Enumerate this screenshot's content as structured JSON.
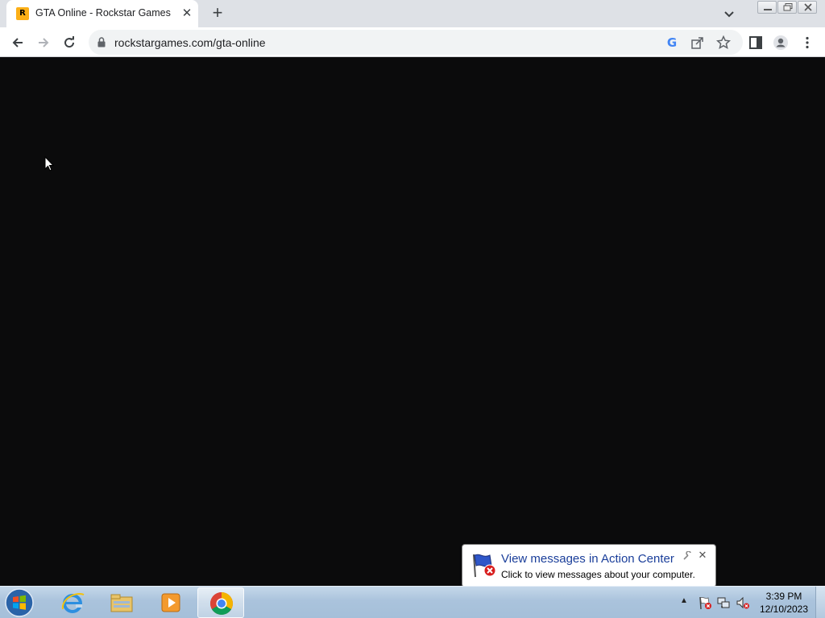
{
  "browser": {
    "tab": {
      "title": "GTA Online - Rockstar Games",
      "favicon_glyph": "R",
      "favicon_icon": "rockstar-logo-icon",
      "close_glyph": "✕"
    },
    "new_tab_glyph": "+",
    "address": {
      "url": "rockstargames.com/gta-online"
    },
    "toolbar_icons": [
      "back-icon",
      "forward-icon",
      "reload-icon",
      "lock-icon",
      "google-icon",
      "share-icon",
      "bookmark-star-icon",
      "side-panel-icon",
      "profile-icon",
      "menu-icon"
    ],
    "google_glyph": "G"
  },
  "notification": {
    "title": "View messages in Action Center",
    "text": "Click to view messages about your computer.",
    "pin_glyph": "🔧",
    "close_glyph": "✕",
    "icon": "action-center-flag-icon"
  },
  "taskbar": {
    "apps": [
      "internet-explorer-icon",
      "file-explorer-icon",
      "media-player-icon",
      "chrome-icon"
    ],
    "tray_arrow": "▲",
    "clock": {
      "time": "3:39 PM",
      "date": "12/10/2023"
    }
  },
  "colors": {
    "page_background": "#0b0b0c",
    "tab_strip": "#dee1e6",
    "notification_title": "#1a3e9a"
  }
}
